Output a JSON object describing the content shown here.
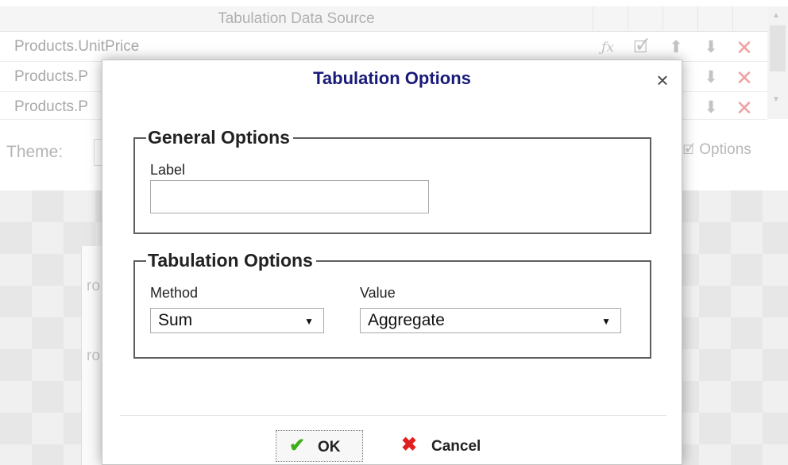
{
  "background": {
    "datasource_title": "Tabulation Data Source",
    "rows": [
      {
        "name": "Products.UnitPrice"
      },
      {
        "name": "Products.P"
      },
      {
        "name": "Products.P"
      }
    ],
    "row_actions": {
      "formula_icon": "ƒx",
      "edit_icon": "edit-icon",
      "up_icon": "arrow-up-icon",
      "down_icon": "arrow-down-icon",
      "delete_icon": "delete-icon"
    },
    "theme_label": "Theme:",
    "options_label": "Options",
    "canvas_text": [
      "ro",
      "ro"
    ]
  },
  "dialog": {
    "title": "Tabulation Options",
    "close_glyph": "×",
    "general": {
      "legend": "General Options",
      "label_caption": "Label",
      "label_value": "",
      "label_placeholder": ""
    },
    "tabulation": {
      "legend": "Tabulation Options",
      "method_caption": "Method",
      "method_value": "Sum",
      "value_caption": "Value",
      "value_value": "Aggregate"
    },
    "buttons": {
      "ok_label": "OK",
      "cancel_label": "Cancel"
    }
  },
  "colors": {
    "title": "#1a1a7a",
    "ok_icon": "#3cae1a",
    "cancel_icon": "#e02020",
    "delete_icon_dimmed": "#f0a2a2"
  }
}
